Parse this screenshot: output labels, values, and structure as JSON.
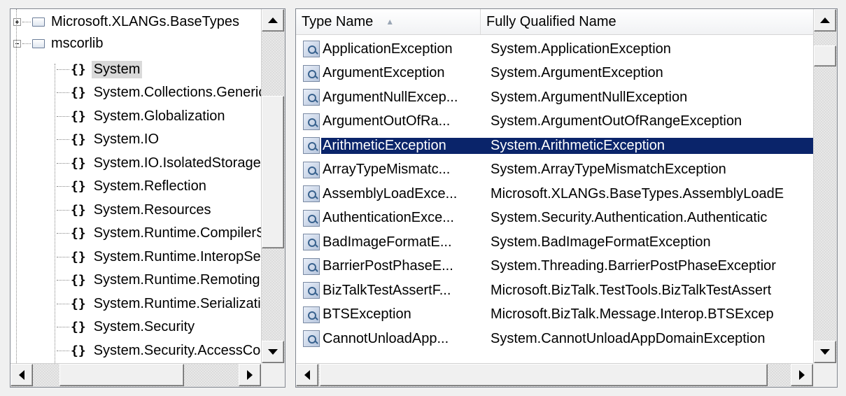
{
  "tree": {
    "items": [
      {
        "label": "Microsoft.XLANGs.BaseTypes",
        "kind": "assembly",
        "expanded": false
      },
      {
        "label": "mscorlib",
        "kind": "assembly",
        "expanded": true
      },
      {
        "label": "System",
        "kind": "namespace",
        "selected": true
      },
      {
        "label": "System.Collections.Generic",
        "kind": "namespace"
      },
      {
        "label": "System.Globalization",
        "kind": "namespace"
      },
      {
        "label": "System.IO",
        "kind": "namespace"
      },
      {
        "label": "System.IO.IsolatedStorage",
        "kind": "namespace"
      },
      {
        "label": "System.Reflection",
        "kind": "namespace"
      },
      {
        "label": "System.Resources",
        "kind": "namespace"
      },
      {
        "label": "System.Runtime.CompilerServices",
        "kind": "namespace"
      },
      {
        "label": "System.Runtime.InteropServices",
        "kind": "namespace"
      },
      {
        "label": "System.Runtime.Remoting",
        "kind": "namespace"
      },
      {
        "label": "System.Runtime.Serialization",
        "kind": "namespace"
      },
      {
        "label": "System.Security",
        "kind": "namespace"
      },
      {
        "label": "System.Security.AccessControl",
        "kind": "namespace"
      }
    ],
    "namespace_glyph": "{}"
  },
  "list": {
    "columns": [
      {
        "label": "Type Name",
        "sorted": "ascending"
      },
      {
        "label": "Fully Qualified Name"
      }
    ],
    "rows": [
      {
        "name": "ApplicationException",
        "fqn": "System.ApplicationException"
      },
      {
        "name": "ArgumentException",
        "fqn": "System.ArgumentException"
      },
      {
        "name": "ArgumentNullExcep...",
        "fqn": "System.ArgumentNullException"
      },
      {
        "name": "ArgumentOutOfRa...",
        "fqn": "System.ArgumentOutOfRangeException"
      },
      {
        "name": "ArithmeticException",
        "fqn": "System.ArithmeticException",
        "selected": true
      },
      {
        "name": "ArrayTypeMismatc...",
        "fqn": "System.ArrayTypeMismatchException"
      },
      {
        "name": "AssemblyLoadExce...",
        "fqn": "Microsoft.XLANGs.BaseTypes.AssemblyLoadE"
      },
      {
        "name": "AuthenticationExce...",
        "fqn": "System.Security.Authentication.Authenticatic"
      },
      {
        "name": "BadImageFormatE...",
        "fqn": "System.BadImageFormatException"
      },
      {
        "name": "BarrierPostPhaseE...",
        "fqn": "System.Threading.BarrierPostPhaseExceptior"
      },
      {
        "name": "BizTalkTestAssertF...",
        "fqn": "Microsoft.BizTalk.TestTools.BizTalkTestAssert"
      },
      {
        "name": "BTSException",
        "fqn": "Microsoft.BizTalk.Message.Interop.BTSExcep"
      },
      {
        "name": "CannotUnloadApp...",
        "fqn": "System.CannotUnloadAppDomainException"
      }
    ]
  },
  "colors": {
    "selection": "#0a246a",
    "tree_selection": "#d9d9d9"
  }
}
